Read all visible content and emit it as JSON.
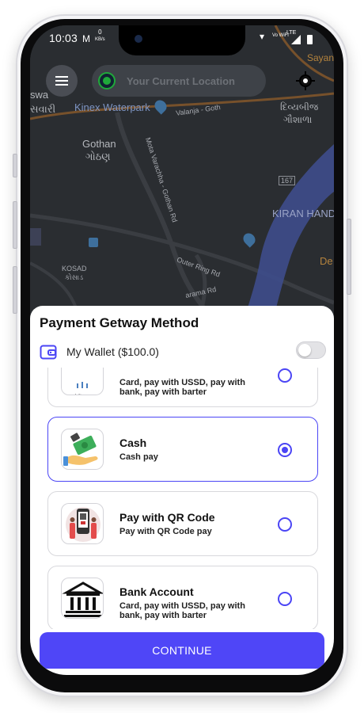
{
  "status_bar": {
    "time": "10:03",
    "speed_value": "0",
    "speed_unit": "KB/s",
    "wifi_label": "Vo WiFi",
    "network_label": "LTE"
  },
  "map": {
    "labels": [
      "swa",
      "સવારી",
      "Kinex Waterpark",
      "Valanja - Goth",
      "દિવ્યબીજ",
      "ગૌશાળા",
      "Gothan",
      "ગોઠણ",
      "Mota Varachha - Gothan Rd",
      "167",
      "KIRAN HAND",
      "KOSAD",
      "કોસાડ",
      "Outer Ring Rd",
      "De",
      "Sayan",
      "arama Rd"
    ]
  },
  "search": {
    "placeholder": "Your Current Location"
  },
  "sheet": {
    "title": "Payment Getway Method",
    "wallet_label": "My Wallet ($100.0)",
    "wallet_enabled": false
  },
  "payment_methods": [
    {
      "logo": "midtrans",
      "logo_text": "midtrans",
      "name": "",
      "description": "Card, pay with USSD, pay with bank, pay with barter",
      "selected": false
    },
    {
      "logo": "cash-hand-icon",
      "name": "Cash",
      "description": "Cash pay",
      "selected": true
    },
    {
      "logo": "qr-scan-icon",
      "name": "Pay with QR Code",
      "description": "Pay with QR Code pay",
      "selected": false
    },
    {
      "logo": "bank-icon",
      "name": "Bank Account",
      "description": "Card, pay with USSD, pay with bank, pay with barter",
      "selected": false
    }
  ],
  "continue_label": "CONTINUE",
  "colors": {
    "accent": "#4f46f7",
    "map_background": "#2a2d31",
    "location_dot": "#1faa3a"
  }
}
